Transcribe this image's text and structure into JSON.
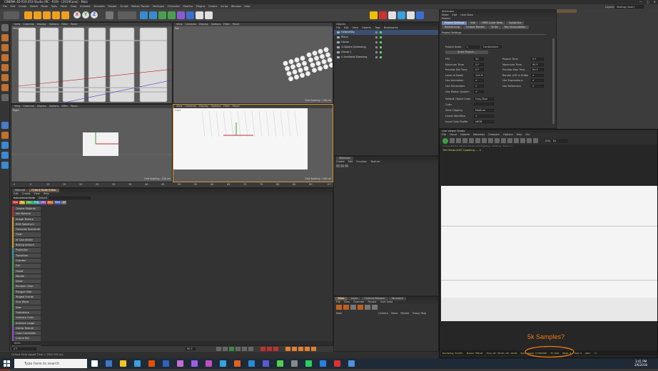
{
  "window": {
    "title": "CINEMA 4D R19.053 Studio (RC - R19) - [2019Cook] - Main"
  },
  "menubar": [
    "File",
    "Edit",
    "Create",
    "Select",
    "Mode",
    "Tools",
    "Mesh",
    "Snap",
    "Animate",
    "Simulate",
    "Render",
    "Sculpt",
    "Motion Tracker",
    "MoGraph",
    "Character",
    "Pipeline",
    "Plugins",
    "Octane",
    "Script",
    "Window",
    "Help"
  ],
  "layout_label": "Layout:",
  "layout_value": "Startup (User)",
  "toolbar": {
    "coord_axes": [
      "X",
      "Y",
      "Z"
    ],
    "coord_axis_colors": [
      "#d04040",
      "#40a040",
      "#4060d0"
    ],
    "undo_icons": [
      "undo-icon",
      "redo-icon"
    ],
    "right_icon_colors": [
      "#f0c000",
      "#d03030",
      "#e0e0e0",
      "#3aa0e0",
      "#e0e0e0",
      "#3a6fd0"
    ]
  },
  "viewports": {
    "menu": [
      "View",
      "Cameras",
      "Display",
      "Options",
      "Filter",
      "Panel"
    ],
    "names": [
      "Perspective",
      "Top",
      "Right",
      "Front"
    ],
    "spacing": [
      "Grid Spacing : 100 cm",
      "Grid Spacing : 100 cm",
      "Grid Spacing : 100 cm"
    ]
  },
  "timeline": {
    "ticks": [
      "0",
      "5",
      "10",
      "15",
      "20",
      "25",
      "30",
      "35",
      "40",
      "45",
      "50",
      "55",
      "60",
      "65",
      "70",
      "75",
      "80",
      "85",
      "90"
    ],
    "end": "0 F",
    "frame_start": "0 F",
    "frame_end": "90 F",
    "frame_max": "90 F"
  },
  "node_editor": {
    "tabs": [
      "Material",
      "Octane Node Editor"
    ],
    "menu": [
      "Edit",
      "Create",
      "View",
      "Help"
    ],
    "add_label": "Add octane Node",
    "search_label": "Search",
    "filters": [
      "Mat",
      "Tex",
      "Gen",
      "Proj",
      "Oth",
      "Emi",
      "Med",
      "All"
    ],
    "filter_colors": [
      "#c03030",
      "#d0a030",
      "#50a050",
      "#30a0a0",
      "#9050c0",
      "#d06020",
      "#4060c0",
      "#707070"
    ],
    "nodes": [
      {
        "label": "Octane Material",
        "color": "#c03030"
      },
      {
        "label": "Mix Material",
        "color": "#c03030"
      },
      {
        "label": "Image Texture",
        "color": "#d0a030"
      },
      {
        "label": "RGB Spectrum",
        "color": "#d0a030"
      },
      {
        "label": "Gaussian Spectrum",
        "color": "#d0a030"
      },
      {
        "label": "Float",
        "color": "#d0a030"
      },
      {
        "label": "W Coordinate",
        "color": "#d0a030"
      },
      {
        "label": "Baking texture",
        "color": "#d0a030"
      },
      {
        "label": "Projection",
        "color": "#30a0a0"
      },
      {
        "label": "Transform",
        "color": "#30a0a0"
      },
      {
        "label": "Checker",
        "color": "#50a050"
      },
      {
        "label": "Dirt",
        "color": "#50a050"
      },
      {
        "label": "Falloff",
        "color": "#50a050"
      },
      {
        "label": "Marble",
        "color": "#50a050"
      },
      {
        "label": "Noise",
        "color": "#50a050"
      },
      {
        "label": "Random Color",
        "color": "#50a050"
      },
      {
        "label": "Polygon Side",
        "color": "#50a050"
      },
      {
        "label": "Ridged Fractal",
        "color": "#50a050"
      },
      {
        "label": "Sine Wave",
        "color": "#50a050"
      },
      {
        "label": "Side",
        "color": "#50a050"
      },
      {
        "label": "Turbulence",
        "color": "#50a050"
      },
      {
        "label": "Instance Color",
        "color": "#50a050"
      },
      {
        "label": "Instance range",
        "color": "#50a050"
      },
      {
        "label": "Clamp Texture",
        "color": "#9050c0"
      },
      {
        "label": "Color Correction",
        "color": "#9050c0"
      },
      {
        "label": "Cosine Mix",
        "color": "#9050c0"
      },
      {
        "label": "Gradient",
        "color": "#9050c0"
      },
      {
        "label": "Invert",
        "color": "#9050c0"
      },
      {
        "label": "Mix",
        "color": "#9050c0"
      },
      {
        "label": "Multiply",
        "color": "#9050c0"
      }
    ],
    "zoom": "100%"
  },
  "transport": {
    "start": "0 F",
    "current": "90 F"
  },
  "status_bar": "Octane Fade sigsoft Time = 2941.991 ms",
  "objects": {
    "menu": [
      "File",
      "Edit",
      "View",
      "Objects",
      "Tags",
      "Bookmarks"
    ],
    "header": "Objects",
    "items": [
      {
        "name": "OctaneSky",
        "sel": true
      },
      {
        "name": "Plane",
        "sel": false
      },
      {
        "name": "Cloner",
        "sel": false
      },
      {
        "name": "3-Sphere (Dressing)",
        "sel": false
      },
      {
        "name": "Cloner.1",
        "sel": false
      },
      {
        "name": "4 Archibald Dressing",
        "sel": false
      }
    ]
  },
  "materials": {
    "tab": "Materials",
    "menu": [
      "Create",
      "Edit",
      "Function",
      "Texture"
    ]
  },
  "layers": {
    "tabs": [
      "Takes",
      "Layer",
      "Content Browser",
      "Structure"
    ],
    "menu": [
      "File",
      "View",
      "Override",
      "Render",
      "User Data"
    ],
    "main": "Main",
    "cols": [
      "Camera",
      "Value",
      "Render",
      "Group Tags"
    ]
  },
  "attributes": {
    "header": "Attributes",
    "menu": [
      "Mode",
      "Edit",
      "User Data"
    ],
    "crumb": "Project",
    "tabs_row1": [
      "Project Settings",
      "Info",
      "HDRI Layer Note",
      "Dynamics"
    ],
    "tabs_row2": [
      "Referencing",
      "Octane Render",
      "To Do",
      "Key Interpolation"
    ],
    "section": "Project Settings",
    "project_scale_label": "Project Scale",
    "project_scale_value": "1",
    "project_scale_unit": "Centimeters",
    "scale_button": "Scale Project...",
    "left_rows": [
      {
        "label": "FPS",
        "value": "30"
      },
      {
        "label": "Minimum Time",
        "value": "0 F"
      },
      {
        "label": "Preview Min Time",
        "value": "0 F"
      },
      {
        "label": "Level of Detail",
        "value": "100 %"
      },
      {
        "label": "Use Animation",
        "value": "✔"
      },
      {
        "label": "Use Generators",
        "value": "✔"
      },
      {
        "label": "Use Motion System",
        "value": "✔"
      }
    ],
    "right_rows": [
      {
        "label": "Project Time",
        "value": "0 F"
      },
      {
        "label": "Maximum Time",
        "value": "90 F"
      },
      {
        "label": "Preview Max Time",
        "value": "90 F"
      },
      {
        "label": "Render LOD in Editor",
        "value": "✔"
      },
      {
        "label": "Use Expressions",
        "value": "✔"
      },
      {
        "label": "Use Deformers",
        "value": "✔"
      }
    ],
    "extra_rows": [
      {
        "label": "Default Object Color",
        "value": "Gray-Blue"
      },
      {
        "label": "Color",
        "value": ""
      },
      {
        "label": "View Clipping",
        "value": "Medium"
      },
      {
        "label": "Linear Workflow",
        "value": "✔"
      },
      {
        "label": "Input Color Profile",
        "value": "sRGB"
      }
    ]
  },
  "live_viewer": {
    "title": "Live Viewer Studio",
    "menu": [
      "File",
      "Cloud",
      "Objects",
      "Materials",
      "Compare",
      "Options",
      "Help",
      "Gui"
    ],
    "channel_label": "Chn",
    "channel_value": "DL",
    "status_line": "Octane Render (Studio) Mode: Directlighting; Updating; Time: 0 s",
    "updating": "TrtO Modo:2067   Updating ....  4",
    "stats": {
      "rendering": "Rendering: 34.00%",
      "ms": "Ms/sec: 386.02",
      "time": "Time: 00 : 00:00 / 00 : 00:00",
      "spp": "Spp/maxspp: 1728/5000",
      "tri": "Tri: 0/0k",
      "mesh": "Mesh: 3",
      "hair": "Hair: 0",
      "gpu": "GPU:",
      "temp": "35°"
    },
    "annotation": "5k Samples?",
    "annotation_color": "#f07a10"
  },
  "taskbar": {
    "search_placeholder": "Type here to search",
    "time": "3:41 PM",
    "date": "2/6/2018",
    "app_colors": [
      "#ffffff",
      "#3a78c8",
      "#f2c420",
      "#3aa0e0",
      "#e45000",
      "#3060c0",
      "#c070d0",
      "#9a60e0",
      "#c050c0",
      "#3aa0e0",
      "#e06020",
      "#2a8ad8",
      "#5a5acf",
      "#50d050",
      "#8a8a8a",
      "#2ad060",
      "#2a80e0",
      "#e03030",
      "#5090e0"
    ]
  }
}
